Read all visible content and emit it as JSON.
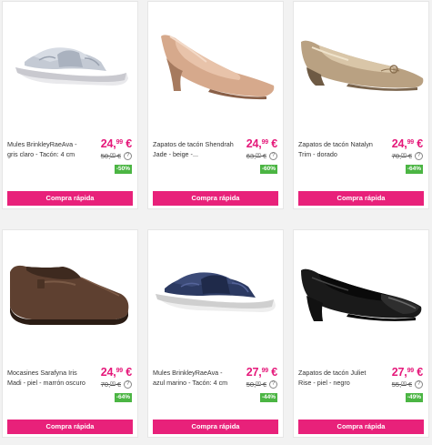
{
  "products": [
    {
      "name": "Mules BrinkleyRaeAva - gris claro - Tacón: 4 cm",
      "price_main": "24,",
      "price_cents": "99",
      "price_currency": " €",
      "old_main": "50,",
      "old_cents": "00",
      "old_currency": " €",
      "discount": "-50%",
      "button": "Compra rápida",
      "image": "grey-slide-sandal"
    },
    {
      "name": "Zapatos de tacón Shendrah Jade - beige -...",
      "price_main": "24,",
      "price_cents": "99",
      "price_currency": " €",
      "old_main": "63,",
      "old_cents": "00",
      "old_currency": " €",
      "discount": "-60%",
      "button": "Compra rápida",
      "image": "beige-pump"
    },
    {
      "name": "Zapatos de tacón Natalyn Trim - dorado",
      "price_main": "24,",
      "price_cents": "99",
      "price_currency": " €",
      "old_main": "70,",
      "old_cents": "00",
      "old_currency": " €",
      "discount": "-64%",
      "button": "Compra rápida",
      "image": "gold-flat"
    },
    {
      "name": "Mocasines Sarafyna Iris Madi - piel - marrón oscuro",
      "price_main": "24,",
      "price_cents": "99",
      "price_currency": " €",
      "old_main": "70,",
      "old_cents": "00",
      "old_currency": " €",
      "discount": "-64%",
      "button": "Compra rápida",
      "image": "brown-loafer"
    },
    {
      "name": "Mules BrinkleyRaeAva - azul marino - Tacón: 4 cm",
      "price_main": "27,",
      "price_cents": "99",
      "price_currency": " €",
      "old_main": "50,",
      "old_cents": "00",
      "old_currency": " €",
      "discount": "-44%",
      "button": "Compra rápida",
      "image": "navy-slide-sandal"
    },
    {
      "name": "Zapatos de tacón Juliet Rise - piel - negro",
      "price_main": "27,",
      "price_cents": "99",
      "price_currency": " €",
      "old_main": "55,",
      "old_cents": "00",
      "old_currency": " €",
      "discount": "-49%",
      "button": "Compra rápida",
      "image": "black-pump"
    }
  ],
  "info_icon": "?",
  "colors": {
    "accent": "#e8217a",
    "price": "#e5187a",
    "discount": "#4bb543"
  }
}
